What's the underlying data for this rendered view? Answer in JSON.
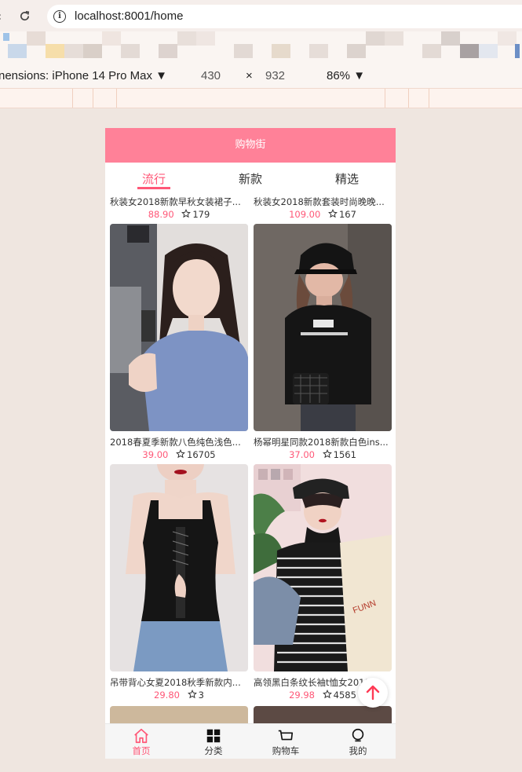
{
  "browser": {
    "url": "localhost:8001/home",
    "back_icon": "back-icon",
    "reload_icon": "reload-icon",
    "info_icon": "info-icon"
  },
  "devtools": {
    "dimensions_label": "nensions: iPhone 14 Pro Max ▼",
    "width": "430",
    "times": "×",
    "height": "932",
    "zoom": "86% ▼"
  },
  "app": {
    "title": "购物街",
    "tabs": [
      {
        "label": "流行",
        "active": true
      },
      {
        "label": "新款",
        "active": false
      },
      {
        "label": "精选",
        "active": false
      }
    ],
    "goods": [
      {
        "title": "秋装女2018新款早秋女装裙子...",
        "price": "88.90",
        "fav": "179"
      },
      {
        "title": "秋装女2018新款套装时尚晚晚...",
        "price": "109.00",
        "fav": "167"
      },
      {
        "title": "2018春夏季新款八色纯色浅色...",
        "price": "39.00",
        "fav": "16705"
      },
      {
        "title": "杨幂明星同款2018新款白色ins...",
        "price": "37.00",
        "fav": "1561"
      },
      {
        "title": "吊带背心女夏2018秋季新款内...",
        "price": "29.80",
        "fav": "3"
      },
      {
        "title": "高领黑白条纹长袖t恤女2018...",
        "price": "29.98",
        "fav": "4585"
      }
    ],
    "tabbar": [
      {
        "label": "首页",
        "icon": "home-icon",
        "active": true
      },
      {
        "label": "分类",
        "icon": "category-icon",
        "active": false
      },
      {
        "label": "购物车",
        "icon": "cart-icon",
        "active": false
      },
      {
        "label": "我的",
        "icon": "profile-icon",
        "active": false
      }
    ]
  },
  "colors": {
    "brand": "#ff8198",
    "accent": "#ff5777",
    "page_bg": "#efe6e0"
  }
}
